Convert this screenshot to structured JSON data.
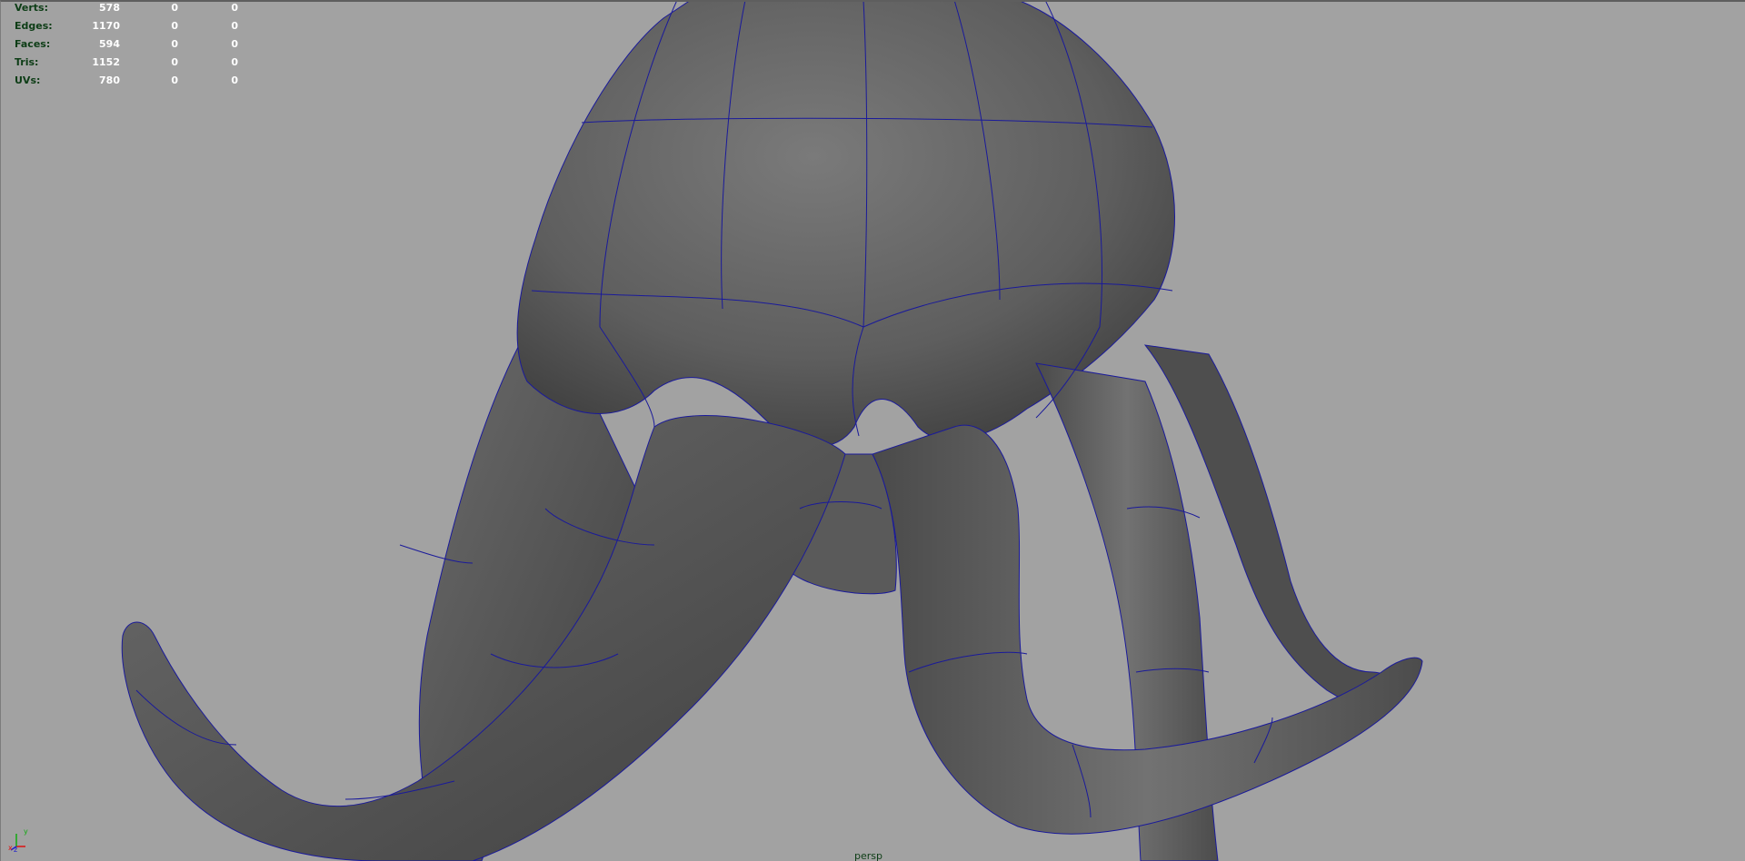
{
  "viewport": {
    "camera": "persp",
    "background": "#a2a2a2",
    "wireframe_color": "#1a1a9a"
  },
  "hud": {
    "rows": [
      {
        "label": "Verts:",
        "v1": "578",
        "v2": "0",
        "v3": "0"
      },
      {
        "label": "Edges:",
        "v1": "1170",
        "v2": "0",
        "v3": "0"
      },
      {
        "label": "Faces:",
        "v1": "594",
        "v2": "0",
        "v3": "0"
      },
      {
        "label": "Tris:",
        "v1": "1152",
        "v2": "0",
        "v3": "0"
      },
      {
        "label": "UVs:",
        "v1": "780",
        "v2": "0",
        "v3": "0"
      }
    ]
  },
  "axis": {
    "x_label": "x",
    "y_label": "y",
    "z_label": "z"
  }
}
